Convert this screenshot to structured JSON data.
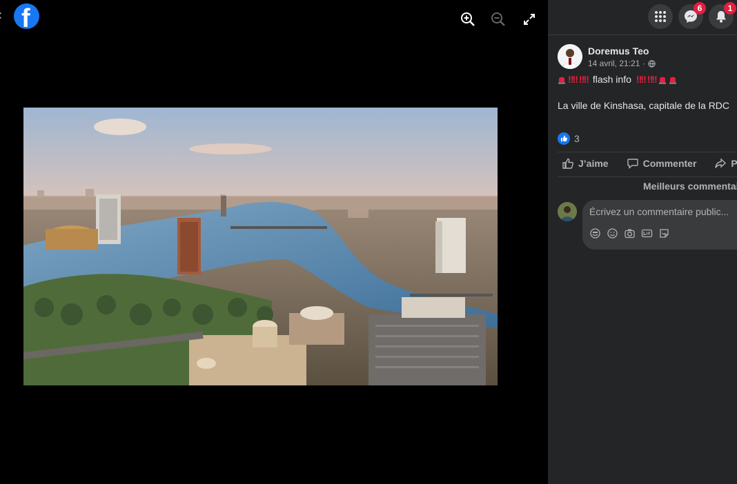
{
  "viewer": {
    "close_glyph": "‹",
    "logo_letter": "f",
    "tools": [
      {
        "icon": "zoom-in-icon"
      },
      {
        "icon": "zoom-out-icon"
      },
      {
        "icon": "fullscreen-icon"
      }
    ]
  },
  "top_bar": {
    "menu_icon": "grid-menu-icon",
    "messenger_badge": "6",
    "notifications_badge": "1"
  },
  "post": {
    "author": "Doremus Teo",
    "timestamp": "14 avril, 21:21 ·",
    "privacy_icon": "globe-icon",
    "line1_text": "flash info",
    "line1_marks": "‼‼",
    "line2": "La ville de Kinshasa, capitale de la RDC",
    "reaction_count": "3"
  },
  "actions": {
    "like": "J’aime",
    "comment": "Commenter",
    "share": "Pa"
  },
  "comments": {
    "sort_label": "Meilleurs commentai",
    "placeholder": "Écrivez un commentaire public..."
  },
  "colors": {
    "accent": "#1877f2",
    "badge": "#e41e3f",
    "panel": "#242526"
  }
}
